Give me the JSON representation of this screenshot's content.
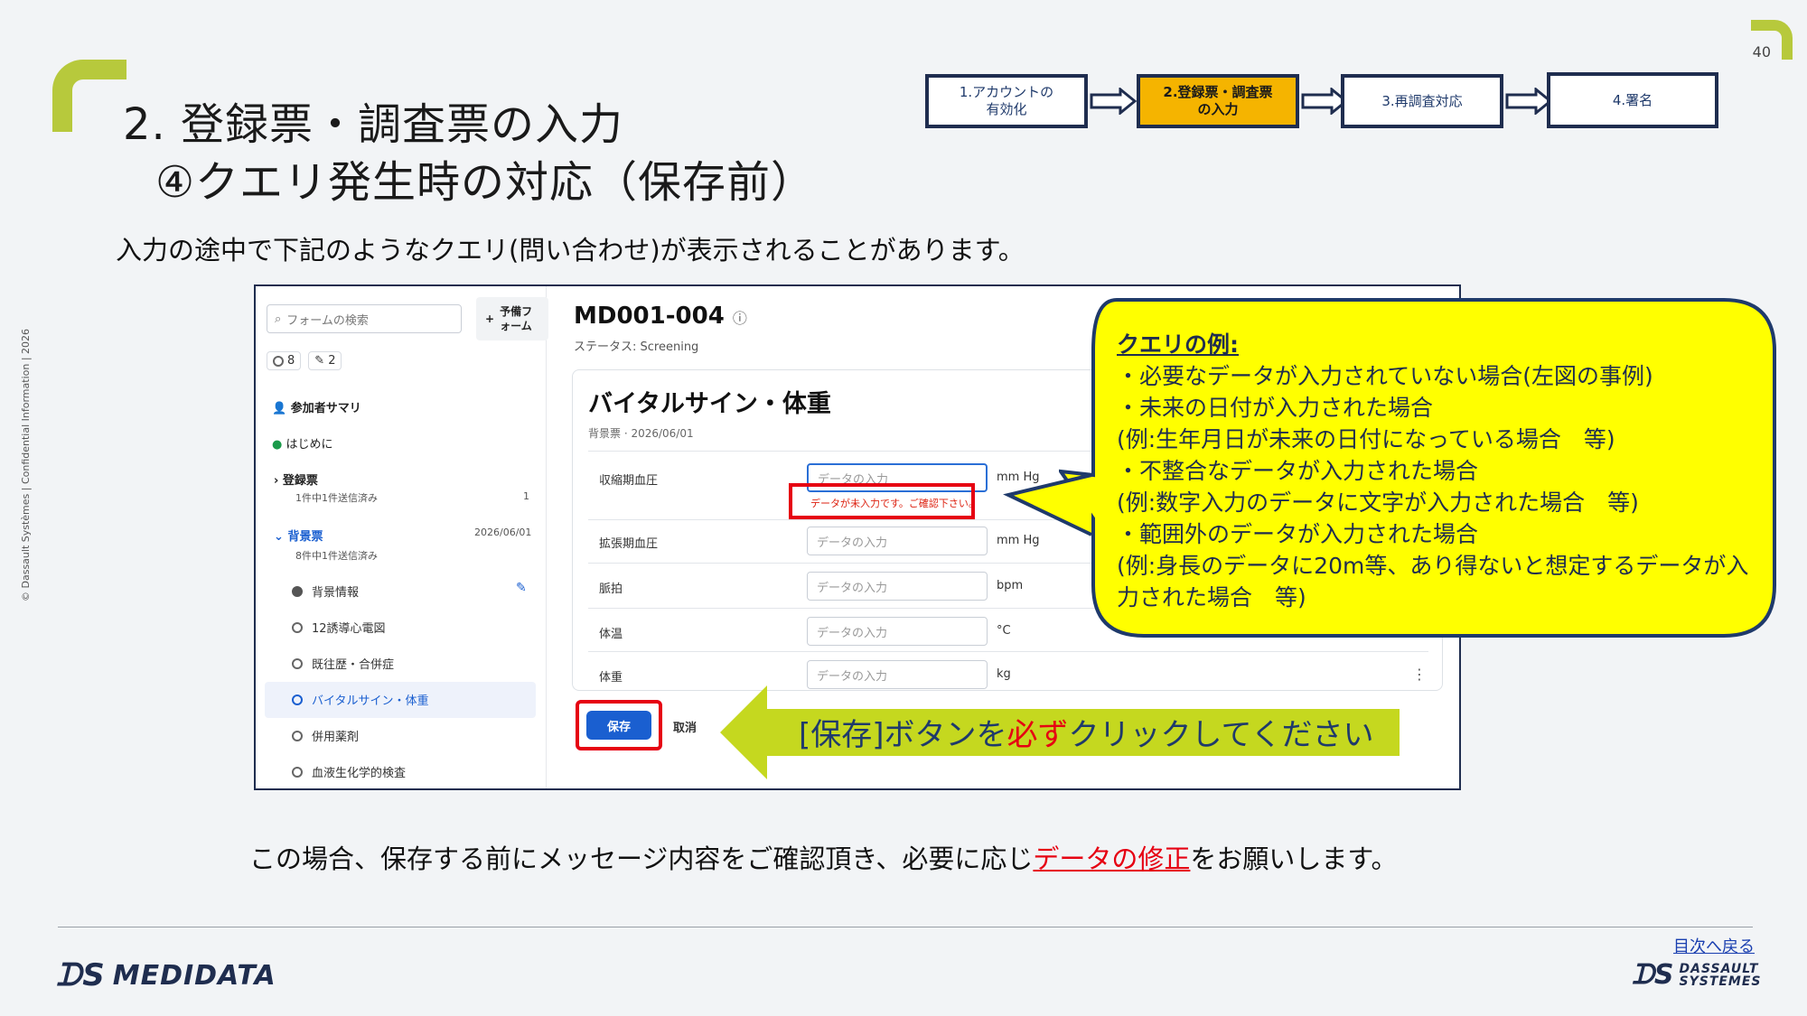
{
  "page_number": "40",
  "title": {
    "line1": "2. 登録票・調査票の入力",
    "line2": "④クエリ発生時の対応（保存前）"
  },
  "steps": [
    {
      "label": "1.アカウントの\n有効化",
      "active": false
    },
    {
      "label": "2.登録票・調査票\nの入力",
      "active": true
    },
    {
      "label": "3.再調査対応",
      "active": false
    },
    {
      "label": "4.署名",
      "active": false
    }
  ],
  "intro": "入力の途中で下記のようなクエリ(問い合わせ)が表示されることがあります。",
  "screenshot": {
    "search_placeholder": "フォームの検索",
    "new_form": "予備フォーム",
    "counts": {
      "open": "8",
      "edit": "2"
    },
    "nav": {
      "summary": "参加者サマリ",
      "intro": "はじめに",
      "registration": {
        "label": "登録票",
        "sub": "1件中1件送信済み",
        "badge": "1"
      },
      "background": {
        "label": "背景票",
        "sub": "8件中1件送信済み",
        "date": "2026/06/01"
      },
      "forms": [
        "背景情報",
        "12誘導心電図",
        "既往歴・合併症",
        "バイタルサイン・体重",
        "併用薬剤",
        "血液生化学的検査"
      ]
    },
    "subject_id": "MD001-004",
    "status_label": "ステータス: Screening",
    "form_title": "バイタルサイン・体重",
    "form_sub": "背景票 · 2026/06/01",
    "rows": [
      {
        "label": "収縮期血圧",
        "placeholder": "データの入力",
        "unit": "mm Hg"
      },
      {
        "label": "拡張期血圧",
        "placeholder": "データの入力",
        "unit": "mm Hg"
      },
      {
        "label": "脈拍",
        "placeholder": "データの入力",
        "unit": "bpm"
      },
      {
        "label": "体温",
        "placeholder": "データの入力",
        "unit": "°C"
      },
      {
        "label": "体重",
        "placeholder": "データの入力",
        "unit": "kg"
      }
    ],
    "error_message": "データが未入力です。ご確認下さい。",
    "save": "保存",
    "cancel": "取消"
  },
  "bubble": {
    "heading": "クエリの例:",
    "lines": [
      "・必要なデータが入力されていない場合(左図の事例)",
      "・未来の日付が入力された場合",
      "(例:生年月日が未来の日付になっている場合　等)",
      "・不整合なデータが入力された場合",
      "(例:数字入力のデータに文字が入力された場合　等)",
      "・範囲外のデータが入力された場合",
      "(例:身長のデータに20m等、あり得ないと想定するデータが入力された場合　等)"
    ]
  },
  "callout": {
    "before": "[保存]ボタンを",
    "emphasis": "必ず",
    "after": "クリックしてください"
  },
  "bottom": {
    "before": "この場合、保存する前にメッセージ内容をご確認頂き、必要に応じ",
    "emphasis": "データの修正",
    "after": "をお願いします。"
  },
  "footer": {
    "toc_link": "目次へ戻る",
    "logo_left": "MEDIDATA",
    "logo_right_1": "DASSAULT",
    "logo_right_2": "SYSTEMES",
    "vertical_text": "© Dassault Systèmes | Confidential Information | 2026"
  },
  "colors": {
    "accent_green": "#b7c93c",
    "active_step": "#f5b400",
    "bubble": "#ffff00",
    "callout_green": "#c5d81f",
    "error_red": "#e60012"
  }
}
